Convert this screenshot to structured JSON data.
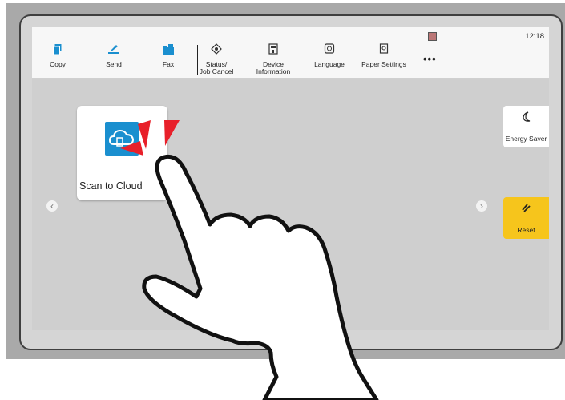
{
  "toolbar": {
    "items": [
      {
        "label": "Copy",
        "icon": "copy-icon"
      },
      {
        "label": "Send",
        "icon": "send-icon"
      },
      {
        "label": "Fax",
        "icon": "fax-icon"
      },
      {
        "label_line1": "Status/",
        "label_line2": "Job Cancel",
        "icon": "status-icon"
      },
      {
        "label_line1": "Device",
        "label_line2": "Information",
        "icon": "device-info-icon"
      },
      {
        "label": "Language",
        "icon": "language-icon"
      },
      {
        "label": "Paper Settings",
        "icon": "paper-settings-icon"
      }
    ],
    "more_label": "•••",
    "time": "12:18"
  },
  "app": {
    "label": "Scan to Cloud",
    "icon": "scan-to-cloud-icon"
  },
  "side": {
    "energy_saver_label": "Energy Saver",
    "reset_label": "Reset"
  },
  "nav": {
    "prev": "‹",
    "next": "›"
  },
  "colors": {
    "accent": "#1a8fcf",
    "reset": "#f6c51c",
    "tap_indicator": "#e8202a"
  }
}
